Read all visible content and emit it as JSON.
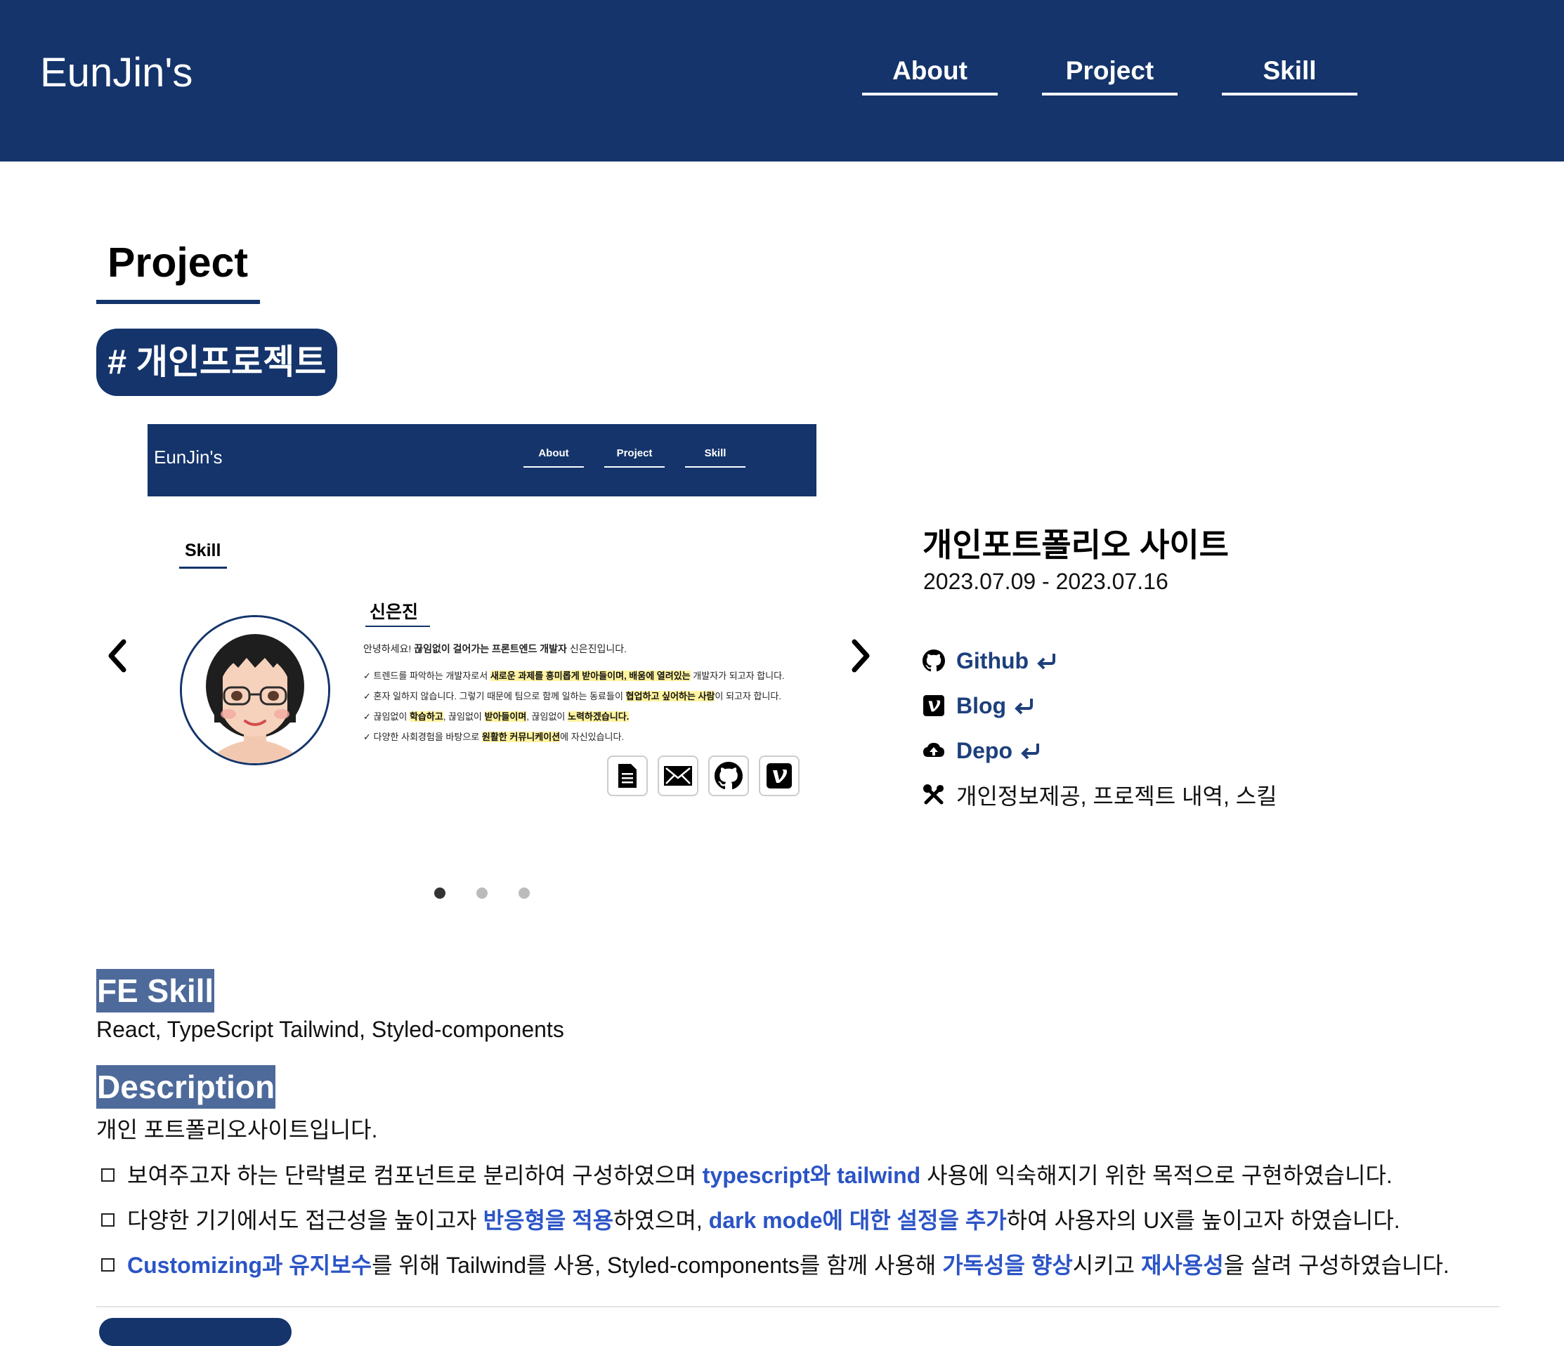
{
  "header": {
    "brand": "EunJin's",
    "nav": [
      "About",
      "Project",
      "Skill"
    ]
  },
  "section": {
    "title": "Project",
    "tag": "# 개인프로젝트"
  },
  "carousel": {
    "active_index": 0,
    "total_slides": 3,
    "slide": {
      "brand": "EunJin's",
      "nav": [
        "About",
        "Project",
        "Skill"
      ],
      "skill_title": "Skill",
      "name": "신은진",
      "intro_prefix": "안녕하세요! ",
      "intro_bold": "끊임없이 걸어가는 프론트엔드 개발자",
      "intro_suffix": " 신은진입니다.",
      "bullets": [
        {
          "pre": "✓ 트렌드를 파악하는 개발자로서 ",
          "hl": "새로운 과제를 흥미롭게 받아들이며, 배움에 열려있는",
          "post": " 개발자가 되고자 합니다."
        },
        {
          "pre": "✓ 혼자 일하지 않습니다. 그렇기 때문에 팀으로 함께 일하는 동료들이 ",
          "hl": "협업하고 싶어하는 사람",
          "post": "이 되고자 합니다."
        },
        {
          "pre": "✓ 끊임없이 ",
          "hl": "학습하고",
          "mid": ", 끊임없이 ",
          "hl2": "받아들이며",
          "mid2": ", 끊임없이 ",
          "hl3": "노력하겠습니다.",
          "post": ""
        },
        {
          "pre": "✓ 다양한 사회경험을 바탕으로 ",
          "hl": "원활한 커뮤니케이션",
          "post": "에 자신있습니다."
        }
      ],
      "icon_names": [
        "document-icon",
        "mail-icon",
        "github-icon",
        "velog-icon"
      ]
    }
  },
  "project": {
    "name": "개인포트폴리오 사이트",
    "period": "2023.07.09 - 2023.07.16",
    "links": {
      "github": "Github",
      "blog": "Blog",
      "deploy": "Depo"
    },
    "features": "개인정보제공, 프로젝트 내역, 스킬",
    "fe_skill_label": "FE Skill",
    "fe_skill": "React, TypeScript Tailwind, Styled-components",
    "description_label": "Description",
    "description": "개인 포트폴리오사이트입니다.",
    "details": [
      {
        "a": "보여주고자 하는 단락별로 컴포넌트로 분리하여 구성하였으며 ",
        "b": "typescript와 tailwind",
        "c": " 사용에 익숙해지기 위한 목적으로 구현하였습니다."
      },
      {
        "a": "다양한 기기에서도 접근성을 높이고자 ",
        "b": "반응형을 적용",
        "c": "하였으며, ",
        "d": "dark mode에 대한 설정을 추가",
        "e": "하여 사용자의 UX를 높이고자 하였습니다."
      },
      {
        "a": "",
        "b": "Customizing과 유지보수",
        "c": "를 위해 Tailwind를 사용, Styled-components를 함께 사용해 ",
        "d": "가독성을 향상",
        "e": "시키고 ",
        "f": "재사용성",
        "g": "을 살려 구성하였습니다."
      }
    ]
  },
  "colors": {
    "primary": "#14346b",
    "label_bg": "#4d6a9a",
    "link": "#1d3f7c",
    "highlight_text": "#2b54c6",
    "marker": "#fff3a0"
  }
}
